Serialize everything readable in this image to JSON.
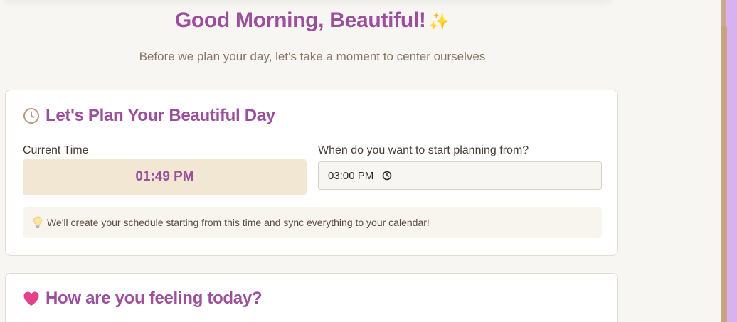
{
  "header": {
    "greeting": "Good Morning, Beautiful!",
    "greeting_emoji": "✨",
    "subtitle": "Before we plan your day, let's take a moment to center ourselves"
  },
  "plan_card": {
    "icon": "clock-icon",
    "title": "Let's Plan Your Beautiful Day",
    "current_time_label": "Current Time",
    "current_time_value": "01:49 PM",
    "start_label": "When do you want to start planning from?",
    "start_time_value": "03:00 PM",
    "start_time_icon": "clock-icon",
    "tip_icon": "lightbulb-icon",
    "tip_text": "We'll create your schedule starting from this time and sync everything to your calendar!"
  },
  "feeling_card": {
    "icon": "heart-icon",
    "title": "How are you feeling today?"
  },
  "colors": {
    "accent": "#9b4f9c",
    "background": "#f8f6f2",
    "current_time_bg": "#f1e7d3",
    "heart": "#e4418d",
    "clock_icon": "#b89b7a"
  }
}
